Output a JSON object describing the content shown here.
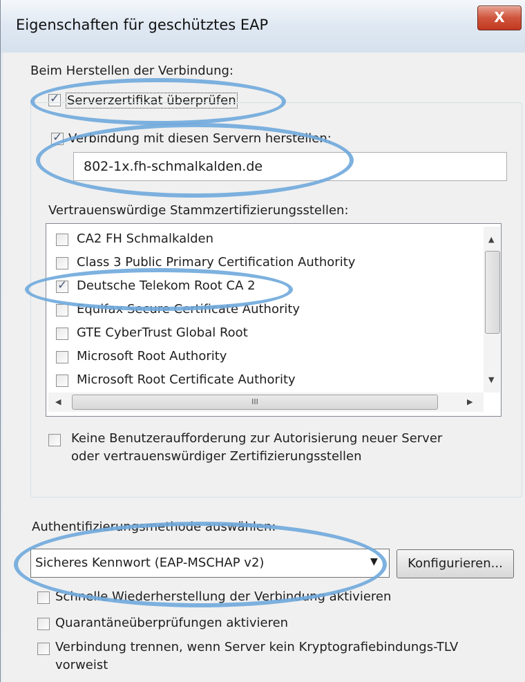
{
  "window": {
    "title": "Eigenschaften für geschütztes EAP",
    "close_glyph": "X"
  },
  "connection": {
    "heading": "Beim Herstellen der Verbindung:",
    "verify_cert_label": "Serverzertifikat überprüfen",
    "connect_servers_label": "Verbindung mit diesen Servern herstellen:",
    "server_value": "802-1x.fh-schmalkalden.de"
  },
  "trusted_roots": {
    "heading": "Vertrauenswürdige Stammzertifizierungsstellen:",
    "items": [
      {
        "label": "CA2 FH Schmalkalden",
        "checked": false
      },
      {
        "label": "Class 3 Public Primary Certification Authority",
        "checked": false
      },
      {
        "label": "Deutsche Telekom Root CA 2",
        "checked": true
      },
      {
        "label": "Equifax Secure Certificate Authority",
        "checked": false
      },
      {
        "label": "GTE CyberTrust Global Root",
        "checked": false
      },
      {
        "label": "Microsoft Root Authority",
        "checked": false
      },
      {
        "label": "Microsoft Root Certificate Authority",
        "checked": false
      }
    ],
    "hscroll_grip": "III"
  },
  "no_prompt": {
    "line1": "Keine Benutzeraufforderung zur Autorisierung neuer Server",
    "line2": "oder vertrauenswürdiger Zertifizierungsstellen"
  },
  "auth": {
    "heading": "Authentifizierungsmethode auswählen:",
    "method_value": "Sicheres Kennwort (EAP-MSCHAP v2)",
    "configure_label": "Konfigurieren..."
  },
  "options": {
    "fast_reconnect": "Schnelle Wiederherstellung der Verbindung aktivieren",
    "quarantine": "Quarantäneüberprüfungen aktivieren",
    "disconnect_line1": "Verbindung trennen, wenn Server kein Kryptografiebindungs-TLV",
    "disconnect_line2": "vorweist"
  },
  "colors": {
    "annotation": "#6fa8dc",
    "close_button": "#c1381f"
  }
}
